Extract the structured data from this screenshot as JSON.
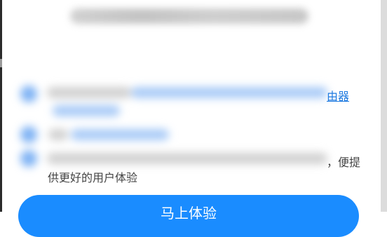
{
  "dialog": {
    "consent_link_tail": "由器",
    "consent_line_tail": "，便提",
    "consent_line_next": "供更好的用户体验",
    "primary_button_label": "马上体验"
  }
}
